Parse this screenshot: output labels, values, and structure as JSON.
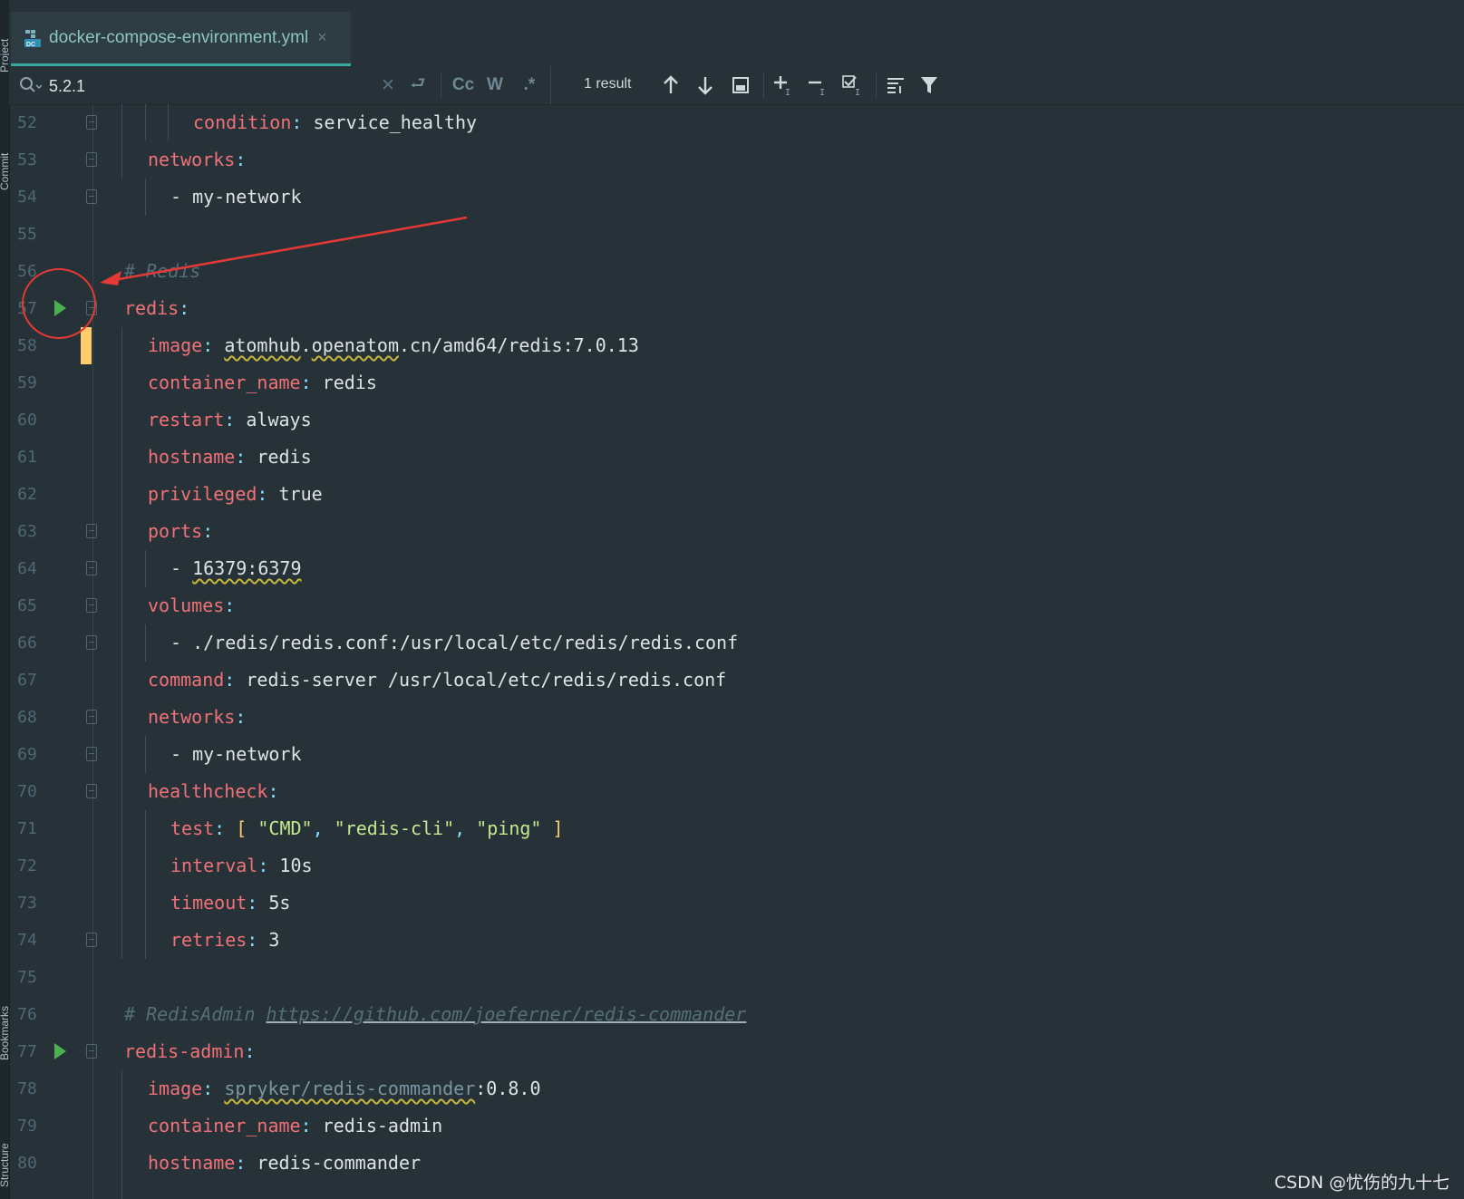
{
  "side_tools": {
    "project_label": "Project",
    "commit_label": "Commit",
    "bookmarks_label": "Bookmarks",
    "structure_label": "Structure"
  },
  "tab": {
    "title": "docker-compose-environment.yml",
    "icon": "docker-compose-file-icon",
    "close_glyph": "×"
  },
  "search": {
    "query": "5.2.1",
    "result_count": "1 result",
    "match_case_label": "Cc",
    "words_label": "W",
    "regex_label": ".*"
  },
  "editor": {
    "lines": [
      {
        "n": "52"
      },
      {
        "n": "53"
      },
      {
        "n": "54"
      },
      {
        "n": "55"
      },
      {
        "n": "56"
      },
      {
        "n": "57"
      },
      {
        "n": "58"
      },
      {
        "n": "59"
      },
      {
        "n": "60"
      },
      {
        "n": "61"
      },
      {
        "n": "62"
      },
      {
        "n": "63"
      },
      {
        "n": "64"
      },
      {
        "n": "65"
      },
      {
        "n": "66"
      },
      {
        "n": "67"
      },
      {
        "n": "68"
      },
      {
        "n": "69"
      },
      {
        "n": "70"
      },
      {
        "n": "71"
      },
      {
        "n": "72"
      },
      {
        "n": "73"
      },
      {
        "n": "74"
      },
      {
        "n": "75"
      },
      {
        "n": "76"
      },
      {
        "n": "77"
      },
      {
        "n": "78"
      },
      {
        "n": "79"
      },
      {
        "n": "80"
      }
    ],
    "code": {
      "l52_key": "condition",
      "l52_val": "service_healthy",
      "l53_key": "networks",
      "l54_val": "- my-network",
      "l56_comment": "# Redis",
      "l57_key": "redis",
      "l58_key": "image",
      "l58_a": "atomhub",
      "l58_b": ".",
      "l58_c": "openatom",
      "l58_d": ".cn/amd64/redis:7.0.13",
      "l59_key": "container_name",
      "l59_val": "redis",
      "l60_key": "restart",
      "l60_val": "always",
      "l61_key": "hostname",
      "l61_val": "redis",
      "l62_key": "privileged",
      "l62_val": "true",
      "l63_key": "ports",
      "l64_dash": "- ",
      "l64_val": "16379:6379",
      "l65_key": "volumes",
      "l66_val": "- ./redis/redis.conf:/usr/local/etc/redis/redis.conf",
      "l67_key": "command",
      "l67_val": "redis-server /usr/local/etc/redis/redis.conf",
      "l68_key": "networks",
      "l69_val": "- my-network",
      "l70_key": "healthcheck",
      "l71_key": "test",
      "l71_s1": "\"CMD\"",
      "l71_s2": "\"redis-cli\"",
      "l71_s3": "\"ping\"",
      "l72_key": "interval",
      "l72_val": "10s",
      "l73_key": "timeout",
      "l73_val": "5s",
      "l74_key": "retries",
      "l74_val": "3",
      "l76_comment": "# RedisAdmin",
      "l76_link": "https://github.com/joeferner/redis-commander",
      "l77_key": "redis-admin",
      "l78_key": "image",
      "l78_a": "spryker/redis-commander",
      "l78_b": ":0.8.0",
      "l79_key": "container_name",
      "l79_val": "redis-admin",
      "l80_key": "hostname",
      "l80_val": "redis-commander"
    }
  },
  "colors": {
    "background": "#263238",
    "key": "#f07178",
    "string": "#c3e88d",
    "accent": "#3aa8a0",
    "run": "#4caf50",
    "annotation": "#e53935"
  },
  "watermark": "CSDN @忧伤的九十七"
}
